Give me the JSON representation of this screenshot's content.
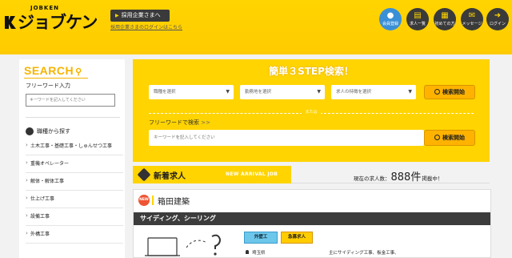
{
  "header": {
    "logo_sub": "JOBKEN",
    "logo_main": "ジョブケン",
    "employer_button": "採用企業さまへ",
    "employer_login_link": "採用企業さまのログインはこちら",
    "icons": [
      {
        "name": "member-registration",
        "label": "会員登録",
        "icon": "person-icon",
        "bg": "#3b8fd6"
      },
      {
        "name": "job-list",
        "label": "求人一覧",
        "icon": "list-icon",
        "bg": "#3a3a3a"
      },
      {
        "name": "about",
        "label": "初めての方",
        "icon": "book-icon",
        "bg": "#3a3a3a"
      },
      {
        "name": "message",
        "label": "メッセージ",
        "icon": "mail-icon",
        "bg": "#3a3a3a"
      },
      {
        "name": "login",
        "label": "ログイン",
        "icon": "login-icon",
        "bg": "#3a3a3a"
      }
    ]
  },
  "sidebar": {
    "search_title": "SEARCH",
    "freeword_label": "フリーワード入力",
    "freeword_placeholder": "キーワードを記入してください",
    "job_type_heading": "職種から探す",
    "categories": [
      "土木工事・基礎工事・しゅんせつ工事",
      "重機オペレーター",
      "解体・解体工事",
      "仕上げ工事",
      "設備工事",
      "外構工事"
    ]
  },
  "main_search": {
    "title": "簡単３STEP検索！",
    "selects": [
      "職種を選択",
      "勤務地を選択",
      "求人の特徴を選択"
    ],
    "search_button": "検索開始",
    "or_text": "または",
    "freeword_label": "フリーワードで検索",
    "freeword_chevron": ">>",
    "freeword_placeholder": "キーワードを記入してください",
    "freeword_button": "検索開始"
  },
  "new_arrival": {
    "title_jp": "新着求人",
    "title_en": "NEW ARRIVAL JOB",
    "count_prefix": "現在の求人数：",
    "count_value": "888件",
    "count_suffix": "掲載中！"
  },
  "job_card": {
    "badge": "NEW",
    "company": "箱田建築",
    "category": "サイディング、シーリング",
    "chips": [
      "外壁工",
      "急募求人"
    ],
    "location": "埼玉県",
    "description": "主にサイディング工事、板金工事、"
  },
  "colors": {
    "brand_yellow": "#ffd400",
    "accent_orange": "#ffb300",
    "dark": "#3a3a3a",
    "member_blue": "#3b8fd6"
  }
}
